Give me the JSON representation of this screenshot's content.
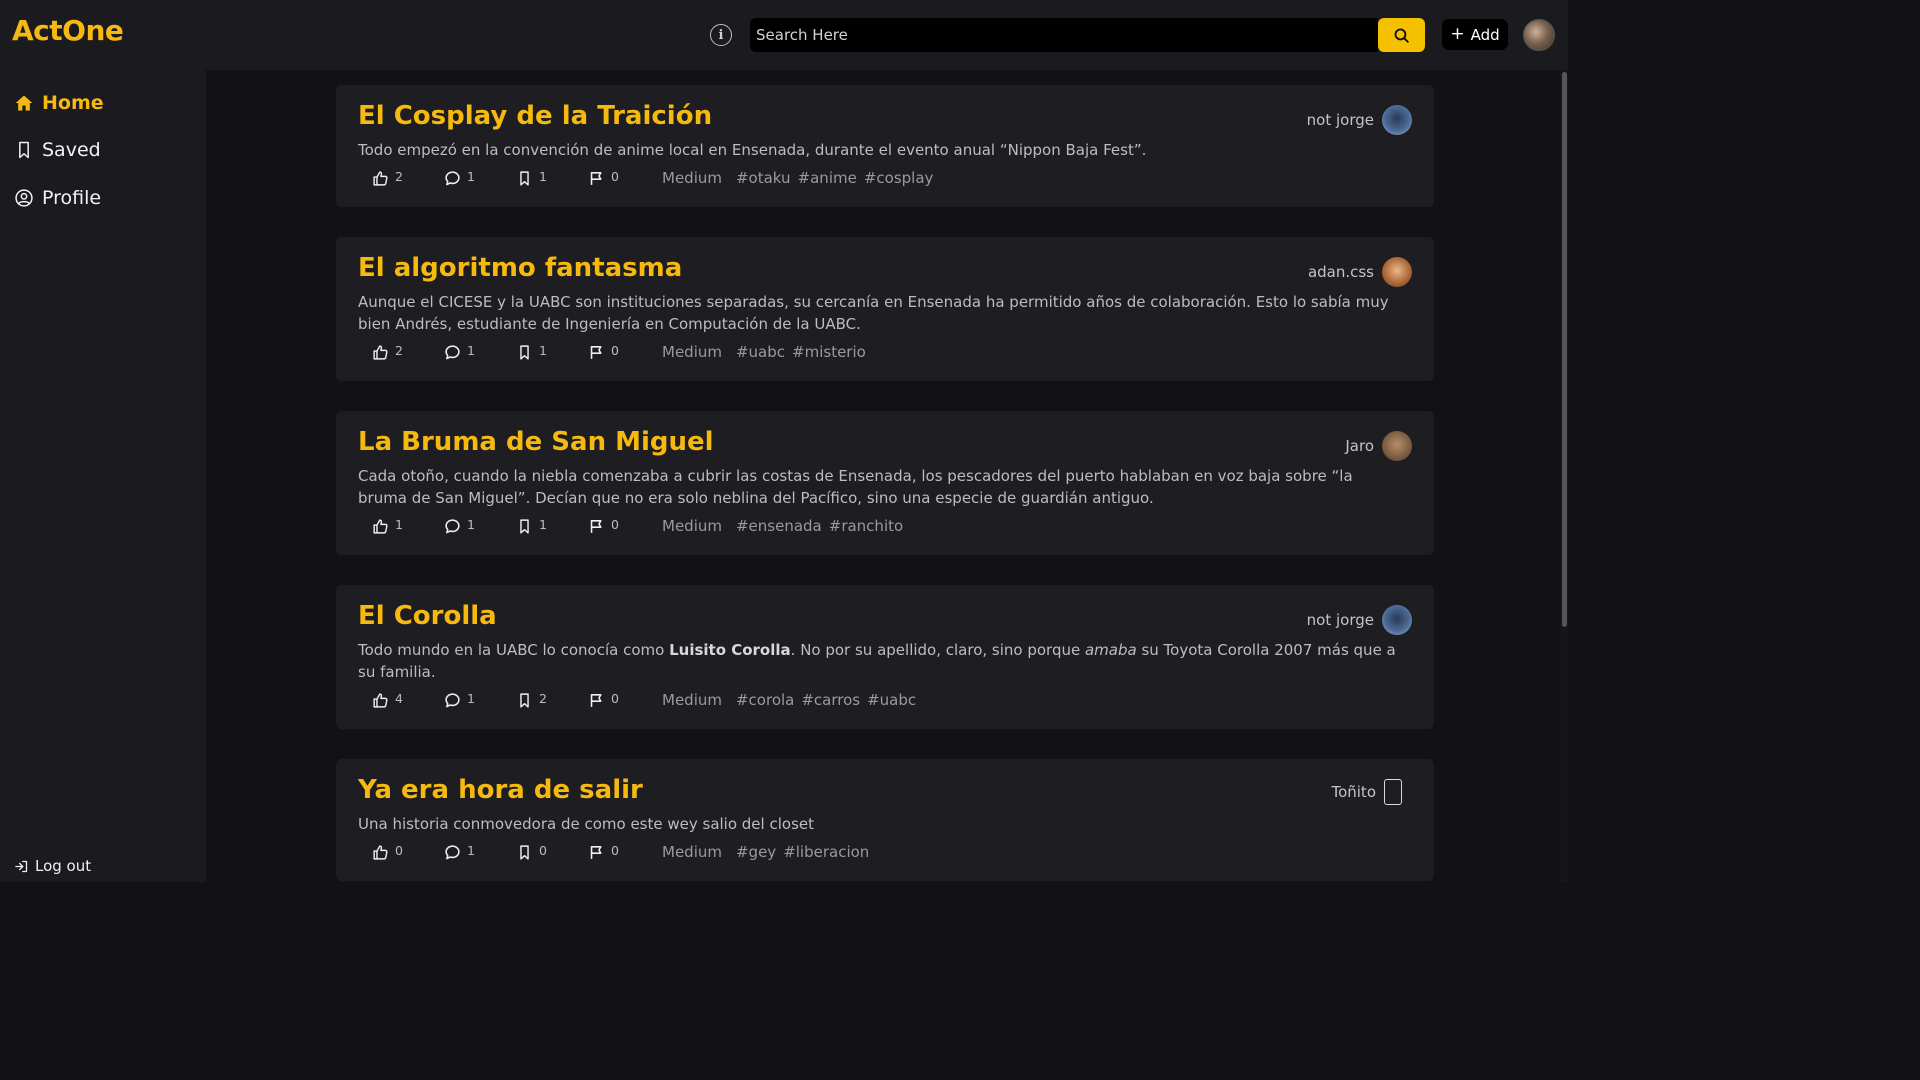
{
  "app": {
    "brand": "ActOne"
  },
  "header": {
    "search_placeholder": "Search Here",
    "add_label": "Add"
  },
  "sidebar": {
    "items": [
      {
        "label": "Home",
        "icon": "home-icon",
        "active": true
      },
      {
        "label": "Saved",
        "icon": "bookmark-icon",
        "active": false
      },
      {
        "label": "Profile",
        "icon": "user-circle-icon",
        "active": false
      }
    ],
    "logout_label": "Log out"
  },
  "colors": {
    "accent": "#f5b90f",
    "background": "#121216",
    "panel": "#1e1e22"
  },
  "posts": [
    {
      "title": "El Cosplay de la Traición",
      "author": "not jorge",
      "excerpt": "Todo empezó en la convención de anime local en Ensenada, durante el evento anual “Nippon Baja Fest”.",
      "likes": "2",
      "comments": "1",
      "saves": "1",
      "reports": "0",
      "level": "Medium",
      "tags": [
        "#otaku",
        "#anime",
        "#cosplay"
      ]
    },
    {
      "title": "El algoritmo fantasma",
      "author": "adan.css",
      "excerpt": "Aunque el CICESE y la UABC son instituciones separadas, su cercanía en Ensenada ha permitido años de colaboración. Esto lo sabía muy bien Andrés, estudiante de Ingeniería en Computación de la UABC.",
      "likes": "2",
      "comments": "1",
      "saves": "1",
      "reports": "0",
      "level": "Medium",
      "tags": [
        "#uabc",
        "#misterio"
      ]
    },
    {
      "title": "La Bruma de San Miguel",
      "author": "Jaro",
      "excerpt": "Cada otoño, cuando la niebla comenzaba a cubrir las costas de Ensenada, los pescadores del puerto hablaban en voz baja sobre “la bruma de San Miguel”. Decían que no era solo neblina del Pacífico, sino una especie de guardián antiguo.",
      "likes": "1",
      "comments": "1",
      "saves": "1",
      "reports": "0",
      "level": "Medium",
      "tags": [
        "#ensenada",
        "#ranchito"
      ]
    },
    {
      "title": "El Corolla",
      "author": "not jorge",
      "excerpt_parts": {
        "a": "Todo mundo en la UABC lo conocía como ",
        "b": "Luisito Corolla",
        "c": ". No por su apellido, claro, sino porque ",
        "d": "amaba",
        "e": " su Toyota Corolla 2007 más que a su familia."
      },
      "likes": "4",
      "comments": "1",
      "saves": "2",
      "reports": "0",
      "level": "Medium",
      "tags": [
        "#corola",
        "#carros",
        "#uabc"
      ]
    },
    {
      "title": "Ya era hora de salir",
      "author": "Toñito",
      "excerpt": "Una historia conmovedora de como este wey salio del closet",
      "likes": "0",
      "comments": "1",
      "saves": "0",
      "reports": "0",
      "level": "Medium",
      "tags": [
        "#gey",
        "#liberacion"
      ]
    }
  ]
}
